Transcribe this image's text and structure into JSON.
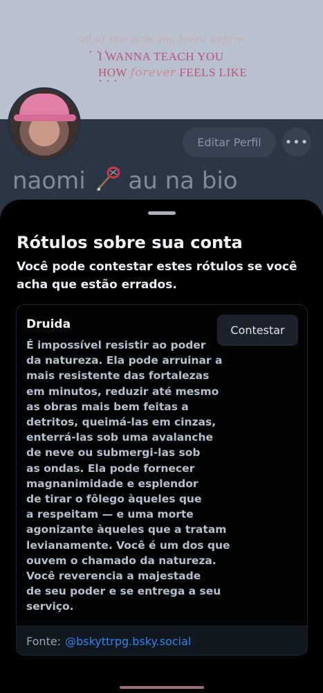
{
  "banner": {
    "script_text": "all of the girls you loved before",
    "line1": "I WANNA TEACH YOU",
    "line2_start": "HOW",
    "line2_script": "forever",
    "line2_end": "FEELS LIKE",
    "dots": "• • •"
  },
  "profile": {
    "edit_label": "Editar Perfil",
    "more_label": "•••",
    "display_name_part1": "naomi",
    "display_name_part2": "au na bio"
  },
  "sheet": {
    "title": "Rótulos sobre sua conta",
    "subtitle": "Você pode contestar estes rótulos se você acha que estão errados."
  },
  "label_card": {
    "name": "Druida",
    "contest_label": "Contestar",
    "description_lines": [
      "É impossível resistir ao poder",
      "da natureza. Ela pode arruinar a",
      "mais resistente das fortalezas",
      "em minutos, reduzir até mesmo",
      "as obras mais bem feitas a",
      "detritos, queimá-las em cinzas,",
      "enterrá-las sob uma avalanche",
      "de neve ou submergi-las sob",
      "as ondas. Ela pode fornecer",
      "magnanimidade e esplendor",
      "de tirar o fôlego àqueles que",
      "a respeitam — e uma morte",
      "agonizante àqueles que a tratam",
      "levianamente. Você é um dos que",
      "ouvem o chamado da natureza.",
      "Você reverencia a majestade",
      "de seu poder e se entrega a seu",
      "serviço."
    ],
    "source_prefix": "Fonte:",
    "source_handle": "@bskyttrpg.bsky.social"
  },
  "colors": {
    "accent_link": "#2f86f0",
    "sheet_bg": "#000000",
    "button_bg": "#1b222c"
  }
}
